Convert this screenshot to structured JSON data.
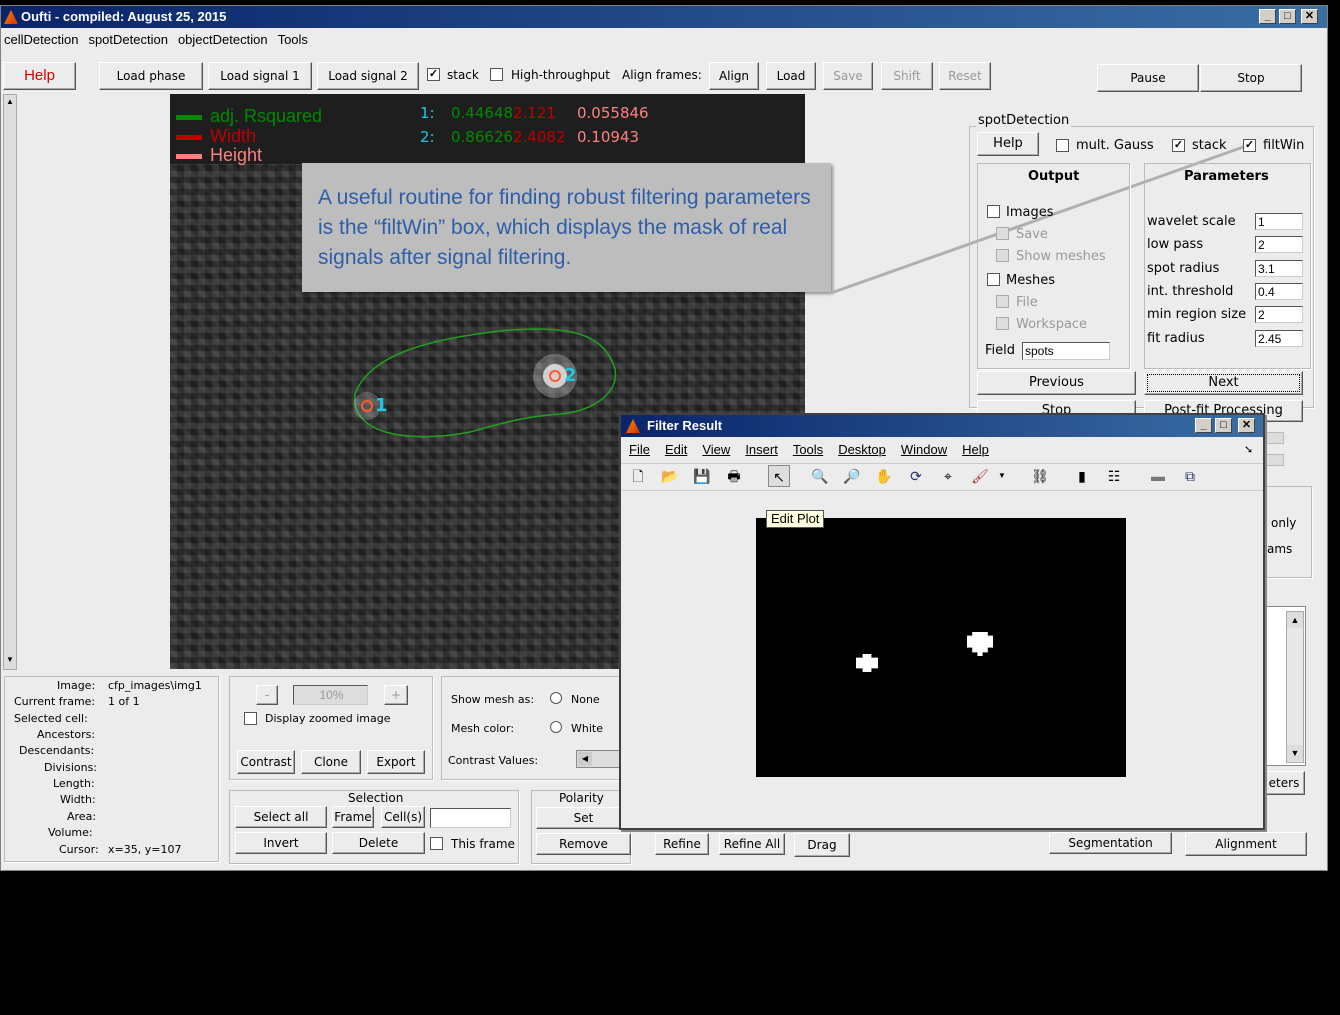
{
  "window": {
    "title": "Oufti - compiled:  August 25, 2015"
  },
  "menu": [
    "cellDetection",
    "spotDetection",
    "objectDetection",
    "Tools"
  ],
  "toolbar": {
    "help": "Help",
    "load_phase": "Load phase",
    "load_signal1": "Load signal 1",
    "load_signal2": "Load signal 2",
    "stack": "stack",
    "high_throughput": "High-throughput",
    "align_frames": "Align frames:",
    "align": "Align",
    "load": "Load",
    "save": "Save",
    "shift": "Shift",
    "reset": "Reset",
    "pause": "Pause",
    "stop": "Stop"
  },
  "legend": {
    "item1": "adj. Rsquared",
    "item2": "Width",
    "item3": "Height",
    "c1": "#008a00",
    "c2": "#c00000",
    "c3": "#ff8080"
  },
  "fit_table": {
    "r1_id": "1:",
    "r1_a": "0.44648",
    "r1_b": "2.121",
    "r1_c": "0.055846",
    "r2_id": "2:",
    "r2_a": "0.86626",
    "r2_b": "2.4082",
    "r2_c": "0.10943"
  },
  "spots": {
    "s1": "1",
    "s2": "2"
  },
  "callout": {
    "text": "A useful routine for finding robust filtering parameters is the “filtWin” box, which displays the mask of real signals after signal filtering."
  },
  "spot_detection": {
    "title": "spotDetection",
    "help": "Help",
    "mult_gauss": "mult. Gauss",
    "stack": "stack",
    "filtwin": "filtWin",
    "output_title": "Output",
    "images": "Images",
    "save": "Save",
    "show_meshes": "Show meshes",
    "meshes": "Meshes",
    "file": "File",
    "workspace": "Workspace",
    "field_label": "Field",
    "field_value": "spots",
    "params_title": "Parameters",
    "params": [
      {
        "label": "wavelet scale",
        "value": "1"
      },
      {
        "label": "low pass",
        "value": "2"
      },
      {
        "label": "spot radius",
        "value": "3.1"
      },
      {
        "label": "int. threshold",
        "value": "0.4"
      },
      {
        "label": "min region size",
        "value": "2"
      },
      {
        "label": "fit radius",
        "value": "2.45"
      }
    ],
    "previous": "Previous",
    "next": "Next",
    "stop": "Stop",
    "post_fit": "Post-fit Processing",
    "only": "only",
    "ams": "ams",
    "eters": "eters"
  },
  "info": {
    "image_label": "Image:",
    "image_value": "cfp_images\\img1",
    "frame_label": "Current frame:",
    "frame_value": "1  of 1",
    "selected": "Selected cell:",
    "ancestors": "Ancestors:",
    "descendants": "Descendants:",
    "divisions": "Divisions:",
    "length": "Length:",
    "width": "Width:",
    "area": "Area:",
    "volume": "Volume:",
    "cursor_label": "Cursor:",
    "cursor_value": "x=35, y=107"
  },
  "zoom": {
    "minus": "-",
    "value": "10%",
    "plus": "+",
    "display_zoomed": "Display zoomed image",
    "contrast": "Contrast",
    "clone": "Clone",
    "export": "Export"
  },
  "mesh": {
    "show_mesh": "Show mesh as:",
    "none": "None",
    "mesh_color": "Mesh color:",
    "white": "White",
    "contrast_values": "Contrast Values:"
  },
  "selection": {
    "title": "Selection",
    "select_all": "Select all",
    "frame": "Frame",
    "cells": "Cell(s)",
    "invert": "Invert",
    "delete": "Delete",
    "this_frame": "This frame"
  },
  "polarity": {
    "title": "Polarity",
    "set": "Set",
    "remove": "Remove"
  },
  "bottom": {
    "refine": "Refine",
    "refine_all": "Refine All",
    "drag": "Drag",
    "segmentation": "Segmentation",
    "alignment": "Alignment"
  },
  "filter_window": {
    "title": "Filter Result",
    "menu": [
      "File",
      "Edit",
      "View",
      "Insert",
      "Tools",
      "Desktop",
      "Window",
      "Help"
    ],
    "tooltip": "Edit Plot"
  }
}
